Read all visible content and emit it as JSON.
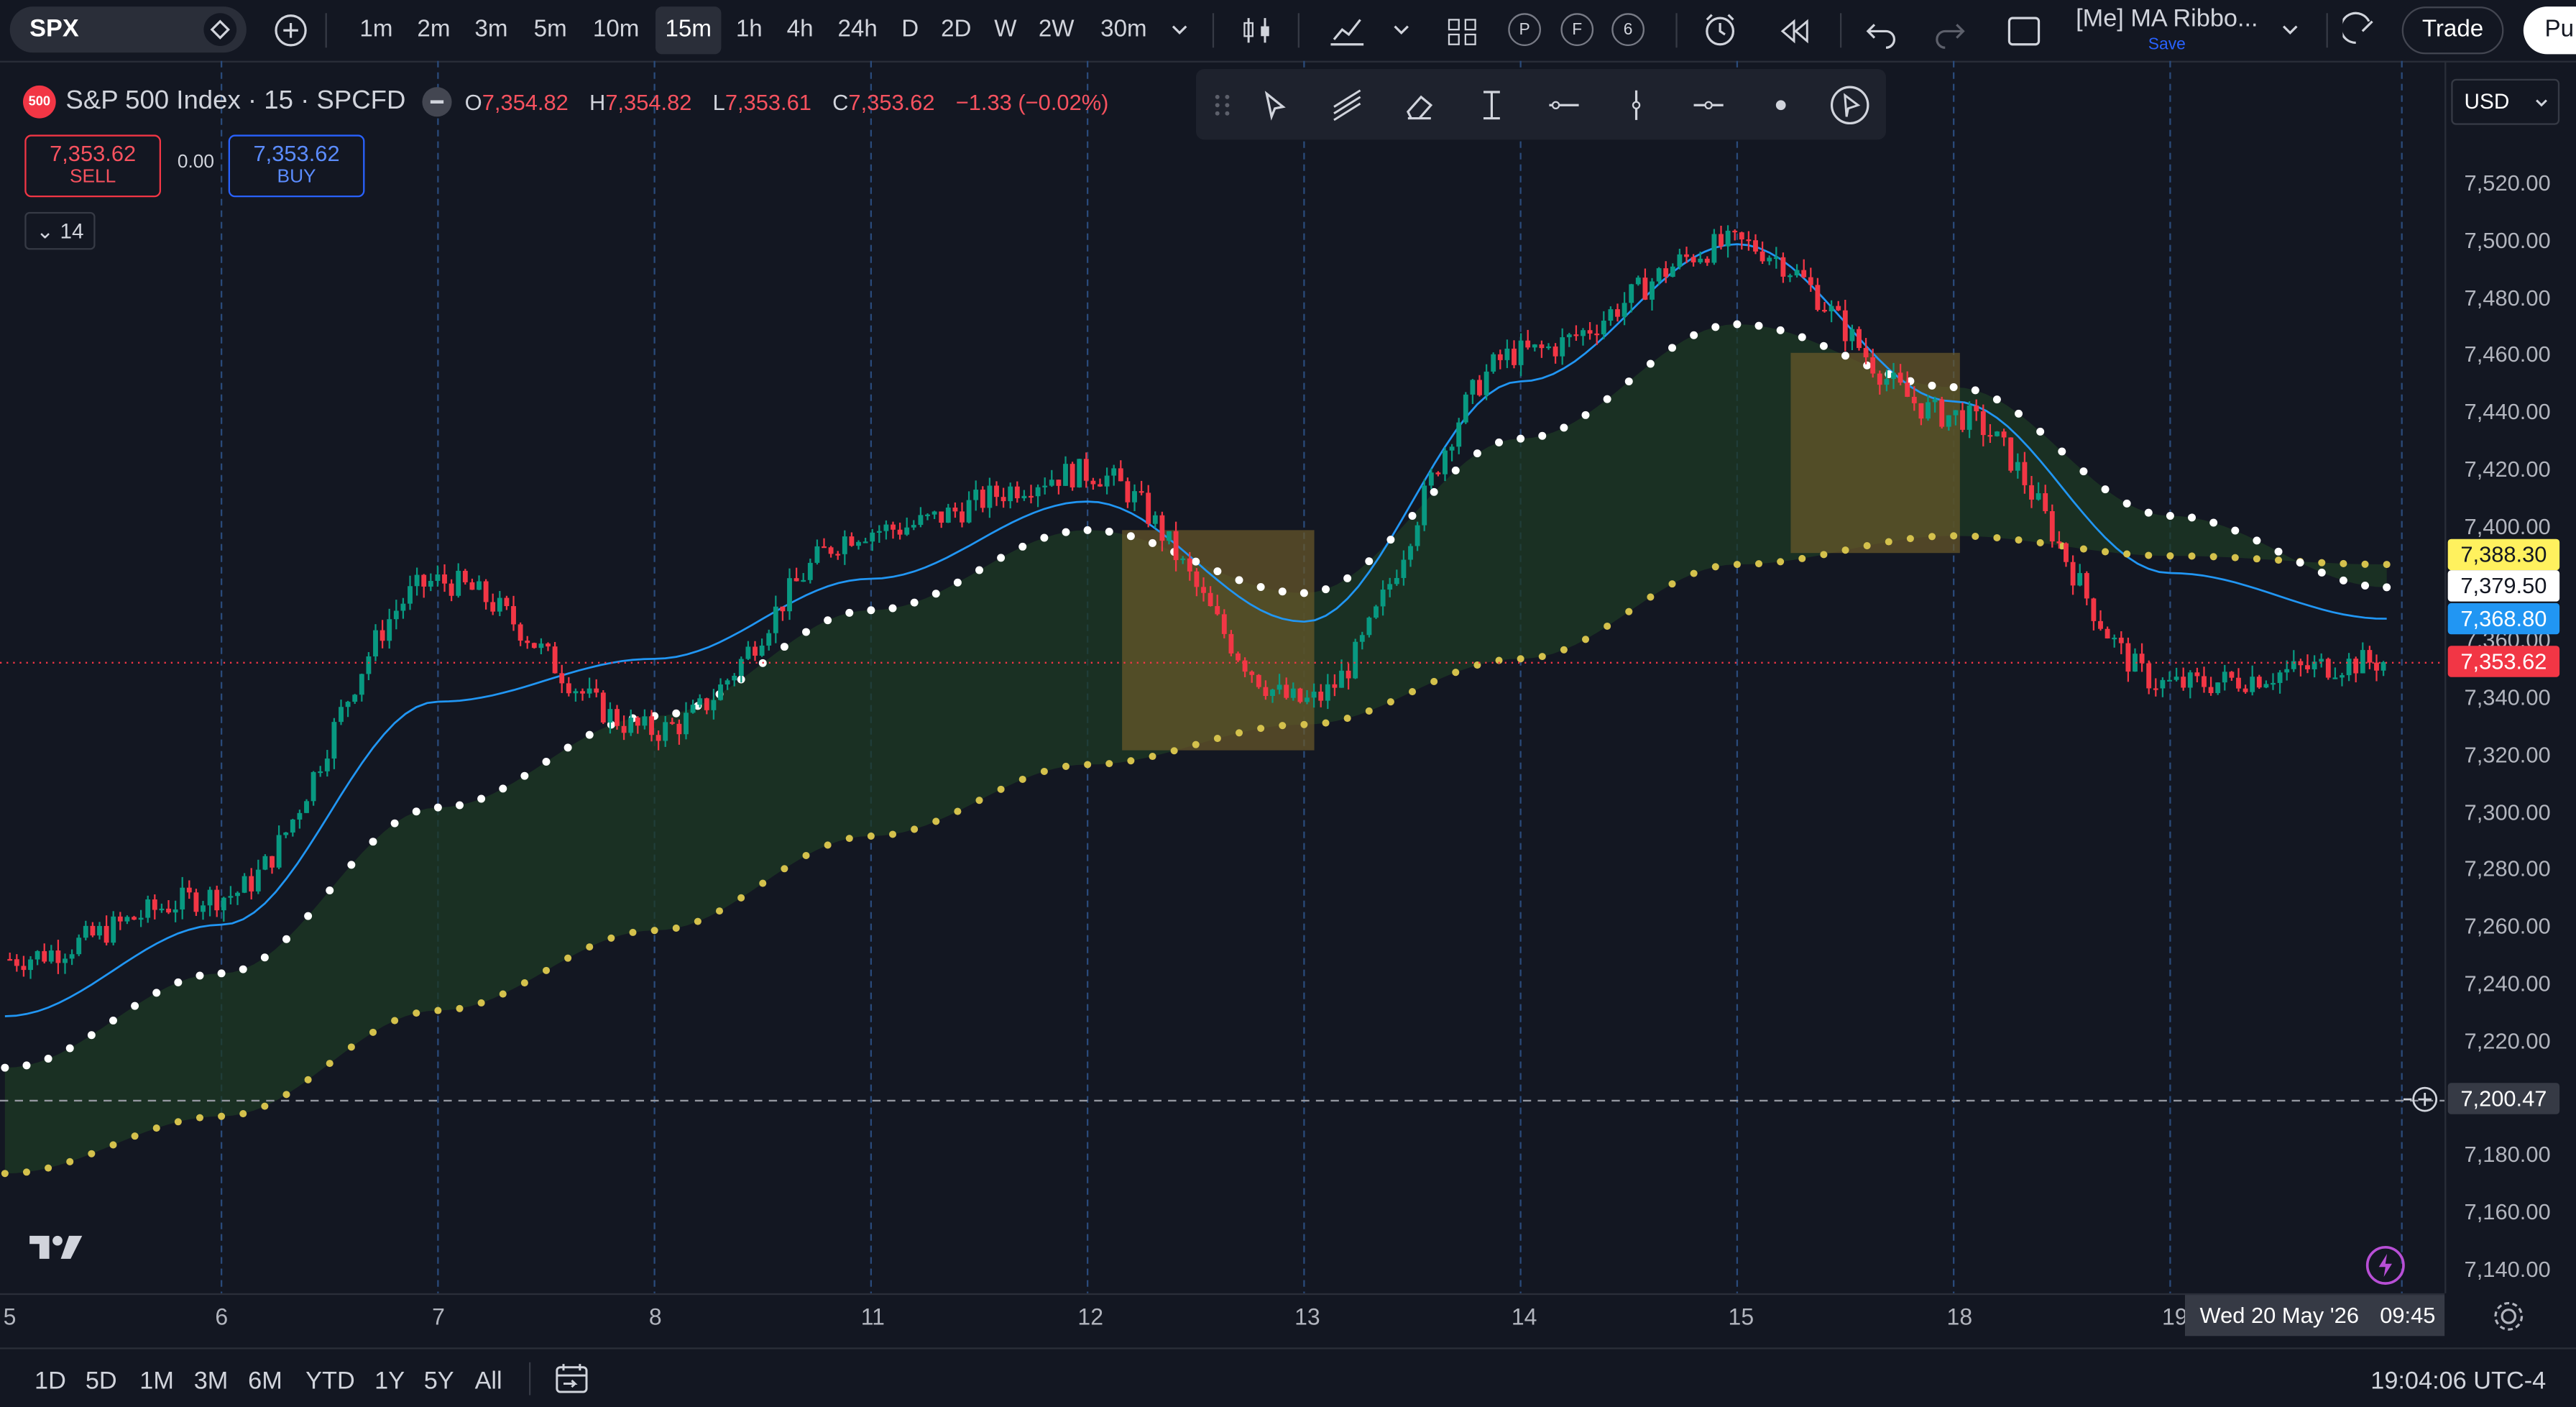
{
  "toolbar": {
    "symbol": "SPX",
    "intervals": [
      "1m",
      "2m",
      "3m",
      "5m",
      "10m",
      "15m",
      "1h",
      "4h",
      "24h",
      "D",
      "2D",
      "W",
      "2W",
      "30m"
    ],
    "active_interval": "15m",
    "badges": [
      "P",
      "F",
      "6"
    ],
    "layout_name": "[Me] MA Ribbo...",
    "layout_save": "Save",
    "trade_label": "Trade",
    "publish_label": "Pu"
  },
  "legend": {
    "badge": "500",
    "title": "S&P 500 Index · 15 · SPCFD",
    "open_key": "O",
    "open": "7,354.82",
    "high_key": "H",
    "high": "7,354.82",
    "low_key": "L",
    "low": "7,353.61",
    "close_key": "C",
    "close": "7,353.62",
    "change": "−1.33 (−0.02%)",
    "sell_price": "7,353.62",
    "sell_label": "SELL",
    "spread": "0.00",
    "buy_price": "7,353.62",
    "buy_label": "BUY",
    "collapsed_count": "14"
  },
  "price_scale": {
    "currency": "USD",
    "labels": [
      "7,520.00",
      "7,500.00",
      "7,480.00",
      "7,460.00",
      "7,440.00",
      "7,420.00",
      "7,400.00",
      "7,360.00",
      "7,340.00",
      "7,320.00",
      "7,300.00",
      "7,280.00",
      "7,260.00",
      "7,240.00",
      "7,220.00",
      "7,180.00",
      "7,160.00",
      "7,140.00"
    ],
    "tags": [
      {
        "value": "7,388.30",
        "color": "#fff15e",
        "text_color": "#131722"
      },
      {
        "value": "7,379.50",
        "color": "#ffffff",
        "text_color": "#131722"
      },
      {
        "value": "7,368.80",
        "color": "#2196f3",
        "text_color": "#ffffff"
      },
      {
        "value": "7,353.62",
        "color": "#f23645",
        "text_color": "#ffffff"
      }
    ],
    "crosshair_price": "7,200.47"
  },
  "time_axis": {
    "labels": [
      "5",
      "6",
      "7",
      "8",
      "11",
      "12",
      "13",
      "14",
      "15",
      "18",
      "19"
    ],
    "crosshair_time": "Wed 20 May '26",
    "crosshair_clock": "09:45"
  },
  "bottom": {
    "ranges": [
      "1D",
      "5D",
      "1M",
      "3M",
      "6M",
      "YTD",
      "1Y",
      "5Y",
      "All"
    ],
    "clock": "19:04:06 UTC-4"
  },
  "chart_data": {
    "type": "line",
    "title": "S&P 500 Index · 15 · SPCFD",
    "xlabel": "",
    "ylabel": "",
    "x": [
      "5",
      "6",
      "7",
      "8",
      "11",
      "12",
      "13",
      "14",
      "15",
      "18",
      "19",
      "20"
    ],
    "ylim": [
      7130,
      7530
    ],
    "series": [
      {
        "name": "",
        "color": "#d4c14c",
        "values": [
          7175,
          7195,
          7232,
          7260,
          7293,
          7318,
          7332,
          7355,
          7388,
          7398,
          7391,
          7388
        ]
      },
      {
        "name": "",
        "color": "#ffffff",
        "values": [
          7212,
          7245,
          7303,
          7335,
          7372,
          7400,
          7378,
          7432,
          7472,
          7450,
          7405,
          7380
        ]
      },
      {
        "name": "",
        "color": "#2196f3",
        "values": [
          7230,
          7262,
          7340,
          7355,
          7383,
          7410,
          7368,
          7452,
          7500,
          7445,
          7385,
          7369
        ]
      },
      {
        "name": "",
        "color": "#f23645",
        "values": [
          7250,
          7272,
          7382,
          7330,
          7400,
          7420,
          7340,
          7462,
          7500,
          7440,
          7346,
          7354
        ]
      }
    ]
  }
}
